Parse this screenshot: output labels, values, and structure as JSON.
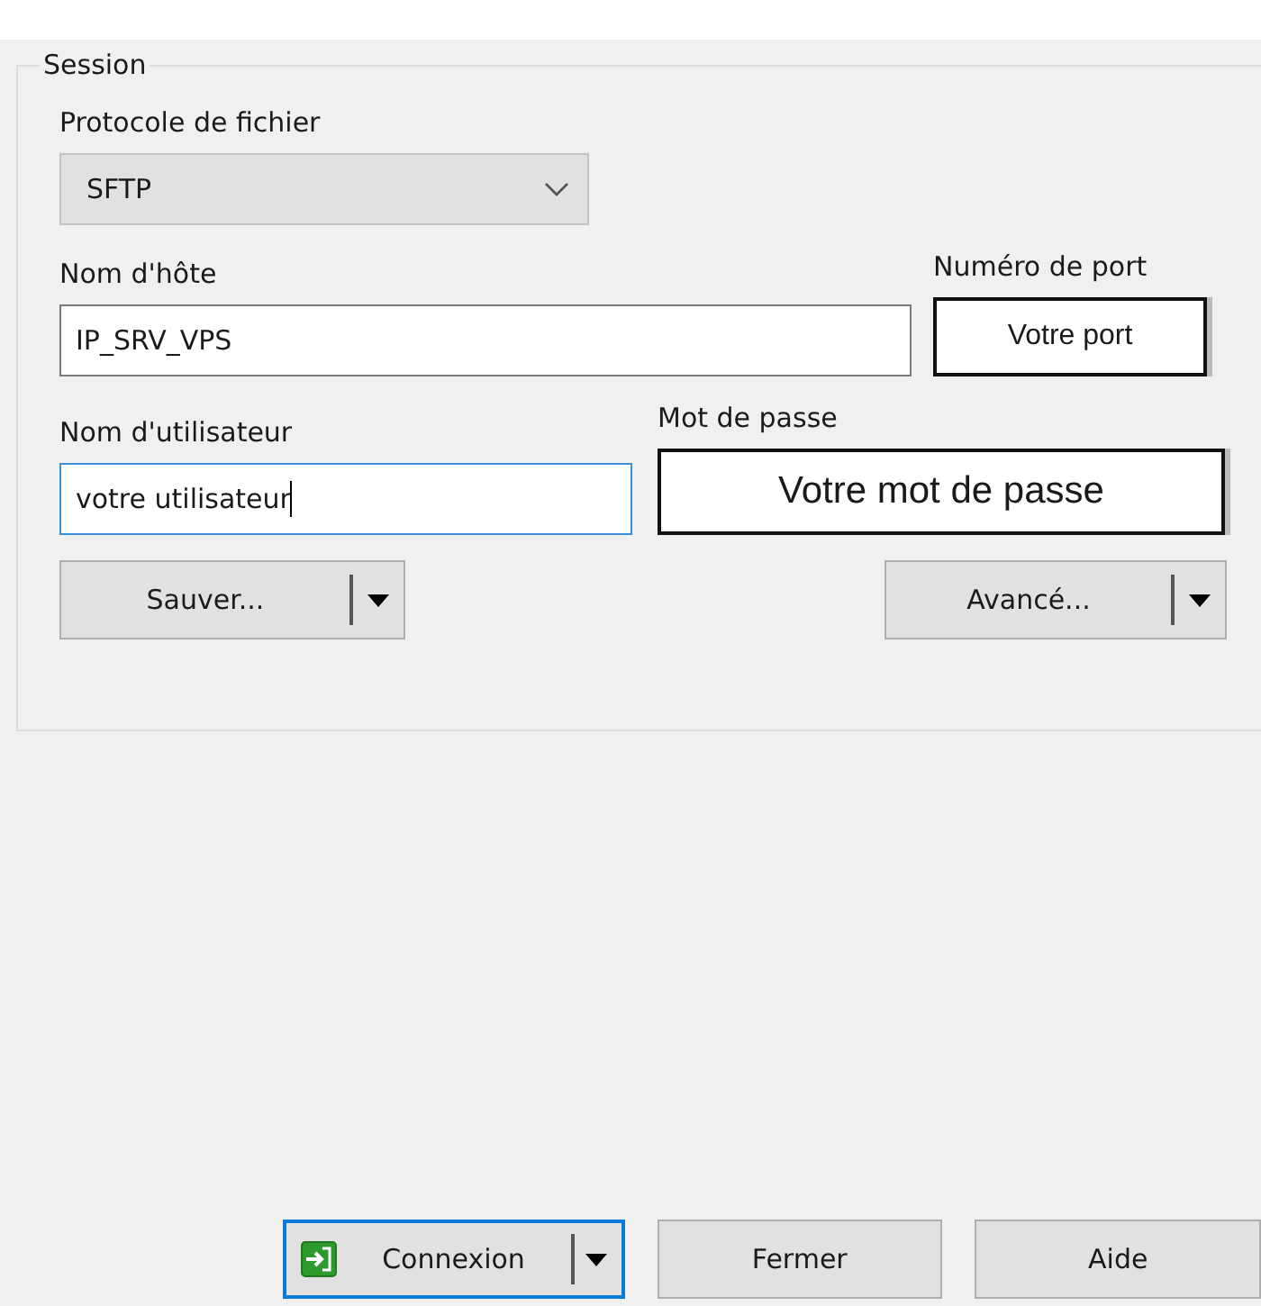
{
  "session": {
    "title": "Session",
    "protocol": {
      "label": "Protocole de fichier",
      "value": "SFTP"
    },
    "host": {
      "label": "Nom d'hôte",
      "value": "IP_SRV_VPS"
    },
    "port": {
      "label": "Numéro de port",
      "value": "Votre port"
    },
    "user": {
      "label": "Nom d'utilisateur",
      "value": "votre utilisateur",
      "focused": true
    },
    "password": {
      "label": "Mot de passe",
      "value": "Votre mot de passe"
    },
    "save_button": "Sauver...",
    "advanced_button": "Avancé..."
  },
  "buttons": [
    {
      "label": "Connexion",
      "kind": "split",
      "focused": true
    },
    {
      "label": "Fermer",
      "kind": "plain",
      "focused": false
    },
    {
      "label": "Aide",
      "kind": "plain",
      "focused": false
    }
  ]
}
